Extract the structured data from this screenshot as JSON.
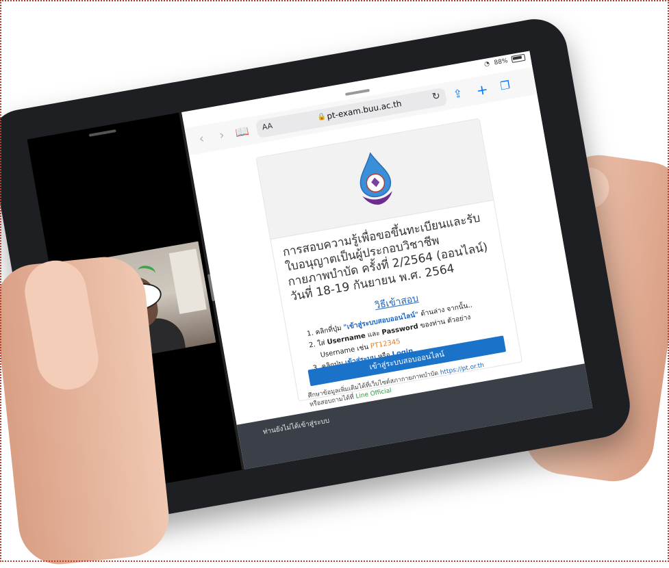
{
  "status_bar": {
    "battery": "88%"
  },
  "browser": {
    "url": "pt-exam.buu.ac.th",
    "text_size_button": "AA",
    "back_glyph": "‹",
    "forward_glyph": "›",
    "bookmarks_glyph": "📖",
    "reload_glyph": "↻",
    "share_glyph": "⇪",
    "new_tab_glyph": "+",
    "tabs_glyph": "❐"
  },
  "card": {
    "title": "การสอบความรู้เพื่อขอขึ้นทะเบียนและรับใบอนุญาตเป็นผู้ประกอบวิชาชีพกายภาพบำบัด ครั้งที่ 2/2564 (ออนไลน์) วันที่ 18-19 กันยายน พ.ศ. 2564",
    "howto_link": "วิธีเข้าสอบ",
    "steps": {
      "s1_num": "1.",
      "s1_a": "คลิกที่ปุ่ม ",
      "s1_link": "\"เข้าสู่ระบบสอบออนไลน์\"",
      "s1_b": " ด้านล่าง จากนั้น..",
      "s2_num": "2.",
      "s2_a": "ใส่ ",
      "s2_user": "Username",
      "s2_b": " และ ",
      "s2_pass": "Password",
      "s2_c": " ของท่าน ตัวอย่าง",
      "s2_example_label": "Username เช่น ",
      "s2_example_value": "PT12345",
      "s3_num": "3.",
      "s3_a": "คลิกปุ่ม ",
      "s3_link": "เข้าสู่ระบบ",
      "s3_b": " หรือ ",
      "s3_login": "Login"
    },
    "login_button": "เข้าสู่ระบบสอบออนไลน์",
    "footnote": {
      "a": "ศึกษาข้อมูลเพิ่มเติมได้ที่เว็บไซต์สภากายภาพบำบัด ",
      "site": "https://pt.or.th",
      "b": "หรือสอบถามได้ที่ ",
      "line": "Line Official"
    }
  },
  "bottom_strip": {
    "text": "ท่านยังไม่ได้เข้าสู่ระบบ"
  }
}
